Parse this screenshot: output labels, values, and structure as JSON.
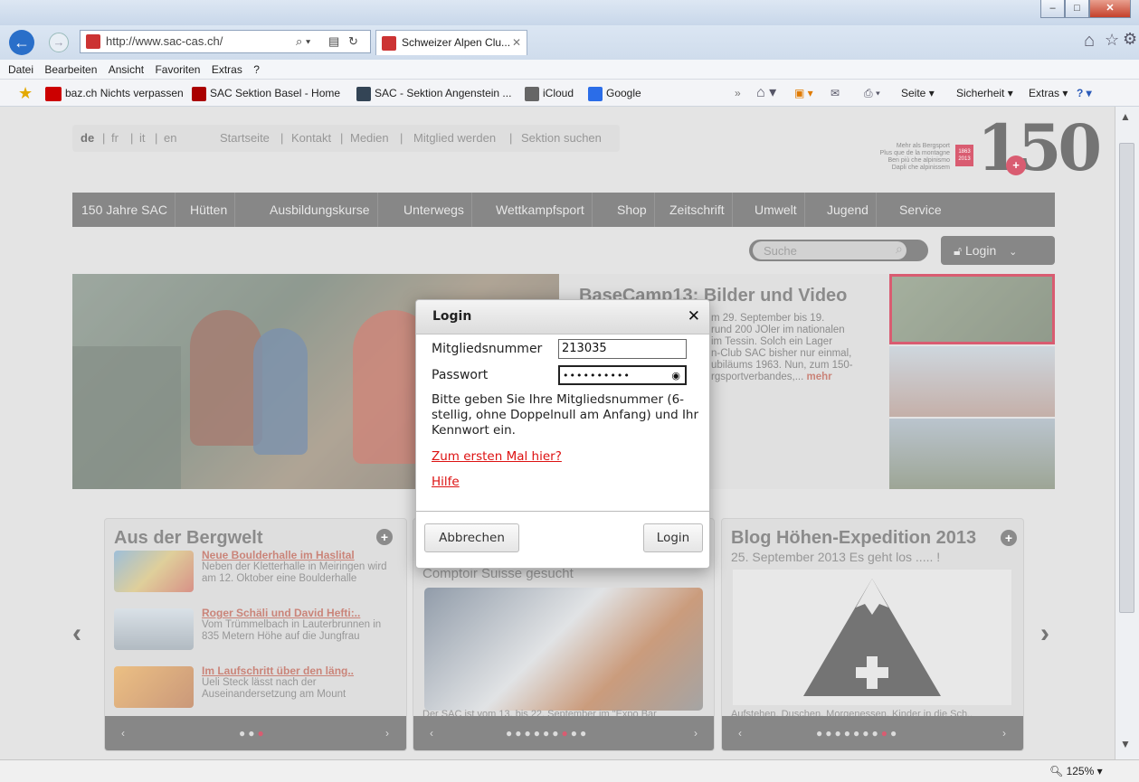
{
  "browser": {
    "address": "http://www.sac-cas.ch/",
    "tab_title": "Schweizer Alpen Clu...",
    "tab_close": "✕",
    "menu": [
      "Datei",
      "Bearbeiten",
      "Ansicht",
      "Favoriten",
      "Extras",
      "?"
    ],
    "favorites": [
      {
        "label": "baz.ch Nichts verpassen",
        "icon": "baz-icon"
      },
      {
        "label": "SAC Sektion Basel - Home",
        "icon": "mountain-icon"
      },
      {
        "label": "SAC - Sektion Angenstein ...",
        "icon": "bird-icon"
      },
      {
        "label": "iCloud",
        "icon": "apple-icon"
      },
      {
        "label": "Google",
        "icon": "google-icon"
      }
    ],
    "toolbar": {
      "page": "Seite",
      "security": "Sicherheit",
      "extras": "Extras"
    },
    "zoom": "125%"
  },
  "site": {
    "languages": [
      "de",
      "fr",
      "it",
      "en"
    ],
    "top_links": [
      "Startseite",
      "Kontakt",
      "Medien",
      "Mitglied werden",
      "Sektion suchen"
    ],
    "main_nav": [
      "150 Jahre SAC",
      "Hütten",
      "Ausbildungskurse",
      "Unterwegs",
      "Wettkampfsport",
      "Shop",
      "Zeitschrift",
      "Umwelt",
      "Jugend",
      "Service"
    ],
    "logo_number": "150",
    "logo_years": "1863 2013",
    "logo_slogans": [
      "Mehr als Bergsport",
      "Plus que de la montagne",
      "Ben più che alpinismo",
      "Dapli che alpinissem"
    ],
    "search_placeholder": "Suche",
    "login_label": "Login",
    "hero_title": "BaseCamp13: Bilder und Video",
    "hero_text_lines": [
      "m 29. September bis 19.",
      "rund 200 JOler im nationalen",
      "im Tessin. Solch ein Lager",
      "n-Club SAC bisher nur einmal,",
      "ubiläums 1963. Nun, zum 150-",
      "rgsportverbandes,..."
    ],
    "hero_more": "mehr",
    "card1": {
      "title": "Aus der Bergwelt",
      "items": [
        {
          "title": "Neue Boulderhalle im Haslital",
          "desc": "Neben der Kletterhalle in Meiringen wird am 12. Oktober eine Boulderhalle"
        },
        {
          "title": "Roger Schäli und David Hefti:..",
          "desc": "Vom Trümmelbach in Lauterbrunnen in 835 Metern Höhe auf die Jungfrau"
        },
        {
          "title": "Im Laufschritt über den läng..",
          "desc": "Ueli Steck lässt nach der Auseinandersetzung am Mount"
        }
      ]
    },
    "card2": {
      "subtitle": "Comptoir Suisse gesucht",
      "caption": "Der SAC ist vom 13. bis 22. September im \"Expo Bar"
    },
    "card3": {
      "title": "Blog Höhen-Expedition 2013",
      "subtitle": "25. September 2013 Es geht los ..... !",
      "caption": "Aufstehen, Duschen, Morgenessen, Kinder in die Sch.."
    }
  },
  "dialog": {
    "title": "Login",
    "member_label": "Mitgliedsnummer",
    "member_value": "213035",
    "password_label": "Passwort",
    "password_value": "••••••••••",
    "help_text": "Bitte geben Sie Ihre Mitgliedsnummer (6-stellig, ohne Doppelnull am Anfang) und Ihr Kennwort ein.",
    "first_time_link": "Zum ersten Mal hier?",
    "help_link": "Hilfe",
    "cancel_button": "Abbrechen",
    "login_button": "Login"
  }
}
